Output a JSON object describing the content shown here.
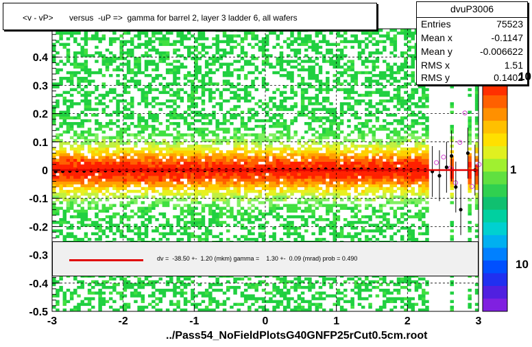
{
  "title": "<v - vP>       versus  -uP =>  gamma for barrel 2, layer 3 ladder 6, all wafers",
  "stats": {
    "name": "dvuP3006",
    "rows": [
      {
        "label": "Entries",
        "value": "75523"
      },
      {
        "label": "Mean x",
        "value": "-0.1147"
      },
      {
        "label": "Mean y",
        "value": "-0.006622"
      },
      {
        "label": "RMS x",
        "value": "1.51"
      },
      {
        "label": "RMS y",
        "value": "0.1402"
      }
    ]
  },
  "fit": {
    "text": "dv =  -38.50 +-  1.20 (mkm) gamma =    1.30 +-  0.09 (mrad) prob = 0.490",
    "color": "#e00000"
  },
  "file_label": "../Pass54_NoFieldPlotsG40GNFP25rCut0.5cm.root",
  "colorbar": {
    "labels": [
      "10",
      "1",
      "10"
    ]
  },
  "chart_data": {
    "type": "heatmap",
    "title": "<v - vP>       versus  -uP =>  gamma for barrel 2, layer 3 ladder 6, all wafers",
    "xlabel": "",
    "ylabel": "",
    "xlim": [
      -3,
      3
    ],
    "ylim": [
      -0.5,
      0.5
    ],
    "xticks": [
      "-3",
      "-2",
      "-1",
      "0",
      "1",
      "2",
      "3"
    ],
    "yticks": [
      "-0.5",
      "-0.4",
      "-0.3",
      "-0.2",
      "-0.1",
      "0",
      "0.1",
      "0.2",
      "0.3",
      "0.4"
    ],
    "grid": true,
    "profile_points": {
      "x": [
        -2.95,
        -2.85,
        -2.75,
        -2.65,
        -2.55,
        -2.45,
        -2.35,
        -2.25,
        -2.15,
        -2.05,
        -1.95,
        -1.85,
        -1.75,
        -1.65,
        -1.55,
        -1.45,
        -1.35,
        -1.25,
        -1.15,
        -1.05,
        -0.95,
        -0.85,
        -0.75,
        -0.65,
        -0.55,
        -0.45,
        -0.35,
        -0.25,
        -0.15,
        -0.05,
        0.05,
        0.15,
        0.25,
        0.35,
        0.45,
        0.55,
        0.65,
        0.75,
        0.85,
        0.95,
        1.05,
        1.15,
        1.25,
        1.35,
        1.45,
        1.55,
        1.65,
        1.75,
        1.85,
        1.95,
        2.05,
        2.15,
        2.25,
        2.35,
        2.45,
        2.55,
        2.62,
        2.68,
        2.75,
        2.85,
        2.95
      ],
      "y": [
        -0.005,
        -0.004,
        -0.003,
        -0.002,
        -0.003,
        -0.002,
        -0.001,
        -0.002,
        -0.001,
        -0.002,
        -0.001,
        -0.002,
        0.0,
        -0.001,
        -0.002,
        -0.001,
        -0.001,
        0.0,
        -0.001,
        0.001,
        0.0,
        -0.001,
        0.0,
        0.001,
        0.0,
        0.001,
        0.0,
        0.0,
        0.001,
        -0.001,
        0.002,
        0.001,
        0.002,
        0.001,
        0.002,
        0.003,
        0.001,
        0.002,
        0.003,
        0.002,
        0.003,
        0.002,
        0.002,
        0.003,
        0.002,
        0.001,
        0.002,
        0.001,
        0.002,
        0.001,
        0.0,
        0.001,
        0.0,
        -0.005,
        -0.02,
        0.01,
        0.05,
        -0.06,
        -0.14,
        0.06,
        0.0
      ]
    },
    "fit_line": {
      "x": [
        -3,
        3
      ],
      "y": [
        -0.0385,
        0.0
      ]
    },
    "z_scale": "log"
  }
}
